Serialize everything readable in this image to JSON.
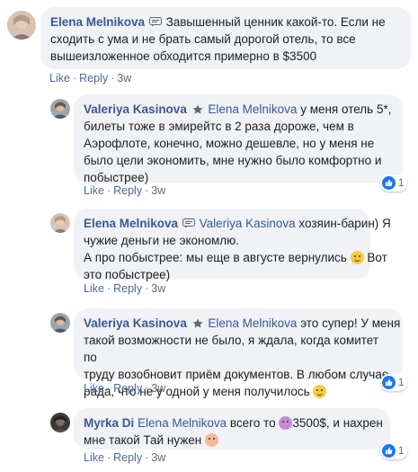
{
  "actions": {
    "like": "Like",
    "reply": "Reply",
    "separator": "·"
  },
  "colors": {
    "bubble": "#f0f2f5",
    "author": "#385898",
    "meta": "#65676b",
    "like_blue": "#1877f2"
  },
  "comments": [
    {
      "author": "Elena Melnikova",
      "badge": "chat-badge-icon",
      "mention": "",
      "lines": [
        "Завышенный ценник какой-то. Если не",
        "сходить с ума и не брать самый дорогой отель, то все",
        "вышеизложенное обходится примерно в $3500"
      ],
      "time": "3w",
      "likes": ""
    },
    {
      "author": "Valeriya Kasinova",
      "badge": "star-badge-icon",
      "mention": "Elena Melnikova",
      "lines": [
        "у меня отель 5*,",
        "билеты тоже в эмирейтс в 2 раза дороже, чем в",
        "Аэрофлоте, конечно, можно дешевле, но у меня не",
        "было цели экономить, мне нужно было комфортно и",
        "побыстрее)"
      ],
      "time": "3w",
      "likes": "1"
    },
    {
      "author": "Elena Melnikova",
      "badge": "chat-badge-icon",
      "mention": "Valeriya Kasinova",
      "lines": [
        "хозяин-барин) Я",
        "чужие деньги не экономлю.",
        "А про побыстрее: мы еще в августе вернулись",
        "Вот",
        "это побыстрее)"
      ],
      "time": "3w",
      "likes": ""
    },
    {
      "author": "Valeriya Kasinova",
      "badge": "star-badge-icon",
      "mention": "Elena Melnikova",
      "lines": [
        "это супер! У меня",
        "такой возможности не было, я ждала, когда комитет по",
        "труду возобновит приём документов. В любом случае,",
        "рада, что не у одной у меня получилось"
      ],
      "time": "3w",
      "likes": "1"
    },
    {
      "author": "Myrka Di",
      "badge": "",
      "mention": "Elena Melnikova",
      "lines": [
        "всего то",
        "3500$, и нахрен",
        "мне такой Тай нужен"
      ],
      "time": "3w",
      "likes": "1"
    }
  ]
}
